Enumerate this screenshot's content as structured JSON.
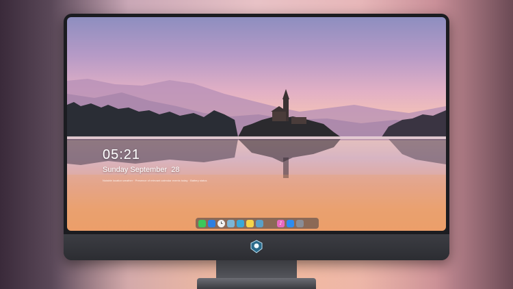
{
  "lock_screen": {
    "time": "05:21",
    "date": "Sunday September  28",
    "info_line": "Notable location weather · Presence of relevant calendar events today · Battery status"
  },
  "dock": {
    "items": [
      {
        "name": "messages",
        "color": "#3cc85a"
      },
      {
        "name": "files",
        "color": "#2f7fe0"
      },
      {
        "name": "clock",
        "color": "#f2f2f2"
      },
      {
        "name": "preview",
        "color": "#7cb6d6"
      },
      {
        "name": "clapper",
        "color": "#3aa8d8"
      },
      {
        "name": "notes",
        "color": "#f5d54a"
      },
      {
        "name": "photos",
        "color": "#5aa0c8"
      },
      {
        "name": "music",
        "color": "#e86ac0"
      },
      {
        "name": "app-store",
        "color": "#2d8cf0"
      },
      {
        "name": "camera",
        "color": "#8a8d96"
      }
    ]
  },
  "colors": {
    "bezel": "#1b1c20",
    "chin": "#34353a"
  }
}
